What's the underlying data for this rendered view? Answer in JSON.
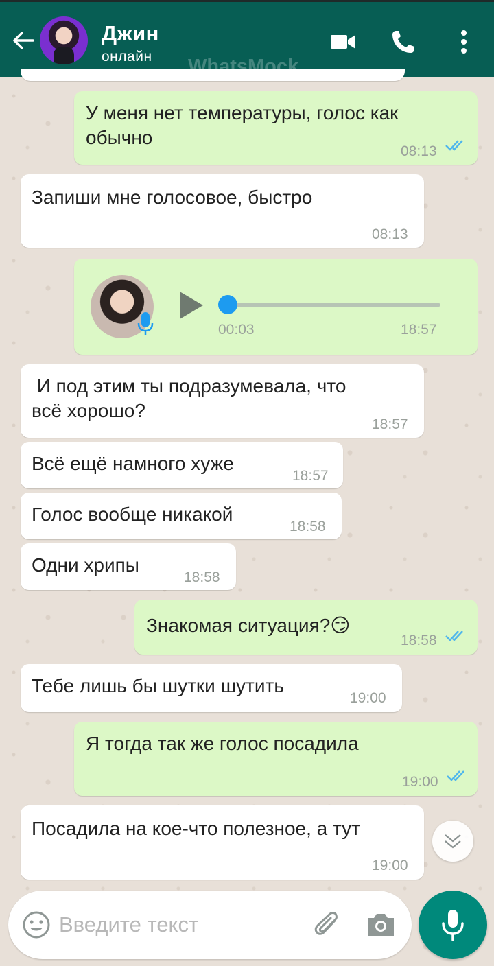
{
  "header": {
    "contact_name": "Джин",
    "status": "онлайн",
    "watermark": "WhatsMock",
    "colors": {
      "bar": "#075e54"
    },
    "icons": [
      "back-arrow-icon",
      "avatar",
      "video-call-icon",
      "phone-icon",
      "more-vert-icon"
    ]
  },
  "messages": [
    {
      "dir": "out",
      "text_line1": "У меня нет температуры, голос как",
      "text_line2": "обычно",
      "time": "08:13",
      "read": true
    },
    {
      "dir": "in",
      "text": "Запиши мне голосовое, быстро",
      "time": "08:13"
    },
    {
      "dir": "out",
      "type": "voice",
      "duration": "00:03",
      "time": "18:57",
      "progress": 0
    },
    {
      "dir": "in",
      "text_line1": " И под этим ты подразумевала, что",
      "text_line2": "всё хорошо?",
      "time": "18:57"
    },
    {
      "dir": "in",
      "text": "Всё ещё намного хуже",
      "time": "18:57"
    },
    {
      "dir": "in",
      "text": "Голос вообще никакой",
      "time": "18:58"
    },
    {
      "dir": "in",
      "text": "Одни хрипы",
      "time": "18:58"
    },
    {
      "dir": "out",
      "text": "Знакомая ситуация?😏",
      "time": "18:58",
      "read": true
    },
    {
      "dir": "in",
      "text": "Тебе лишь бы шутки шутить",
      "time": "19:00"
    },
    {
      "dir": "out",
      "text": "Я тогда так же голос посадила",
      "time": "19:00",
      "read": true
    },
    {
      "dir": "in",
      "text": "Посадила на кое-что полезное, а тут",
      "time": "19:00"
    }
  ],
  "composer": {
    "placeholder": "Введите текст",
    "icons": [
      "emoji-icon",
      "paperclip-icon",
      "camera-icon",
      "mic-icon"
    ]
  },
  "colors": {
    "incoming": "#ffffff",
    "outgoing": "#dcf8c6",
    "read_ticks": "#4fb6ec",
    "send_button": "#00897b"
  }
}
